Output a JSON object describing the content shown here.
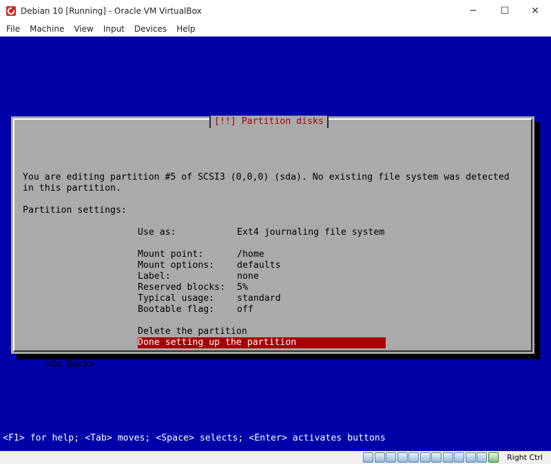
{
  "window": {
    "title": "Debian 10 [Running] - Oracle VM VirtualBox",
    "icons": {
      "app": "virtualbox-icon",
      "minimize": "minimize-icon",
      "maximize": "maximize-icon",
      "close": "close-icon"
    },
    "controls": {
      "minimize": "─",
      "maximize": "☐",
      "close": "✕"
    }
  },
  "menubar": {
    "items": [
      "File",
      "Machine",
      "View",
      "Input",
      "Devices",
      "Help"
    ]
  },
  "installer": {
    "dialog_title": "[!!] Partition disks",
    "intro_line1": "You are editing partition #5 of SCSI3 (0,0,0) (sda). No existing file system was detected",
    "intro_line2": "in this partition.",
    "settings_heading": "Partition settings:",
    "settings": [
      {
        "label": "Use as:",
        "value": "Ext4 journaling file system"
      },
      {
        "label": "Mount point:",
        "value": "/home"
      },
      {
        "label": "Mount options:",
        "value": "defaults"
      },
      {
        "label": "Label:",
        "value": "none"
      },
      {
        "label": "Reserved blocks:",
        "value": "5%"
      },
      {
        "label": "Typical usage:",
        "value": "standard"
      },
      {
        "label": "Bootable flag:",
        "value": "off"
      }
    ],
    "delete_partition": "Delete the partition",
    "done_setting": "Done setting up the partition",
    "go_back": "<Go Back>",
    "help_line": "<F1> for help; <Tab> moves; <Space> selects; <Enter> activates buttons"
  },
  "statusbar": {
    "icons": [
      "hard-disk-icon",
      "optical-drive-icon",
      "audio-icon",
      "network-icon",
      "usb-icon",
      "shared-folders-icon",
      "display-icon",
      "video-capture-icon",
      "mouse-integration-icon",
      "keyboard-capture-icon",
      "cpu-icon",
      "host-key-arrow-icon"
    ],
    "host_key": "Right Ctrl"
  },
  "colors": {
    "vm_background": "#0000a8",
    "dialog_background": "#aaaaaa",
    "dialog_title": "#a80000",
    "selection": "#a80000"
  }
}
